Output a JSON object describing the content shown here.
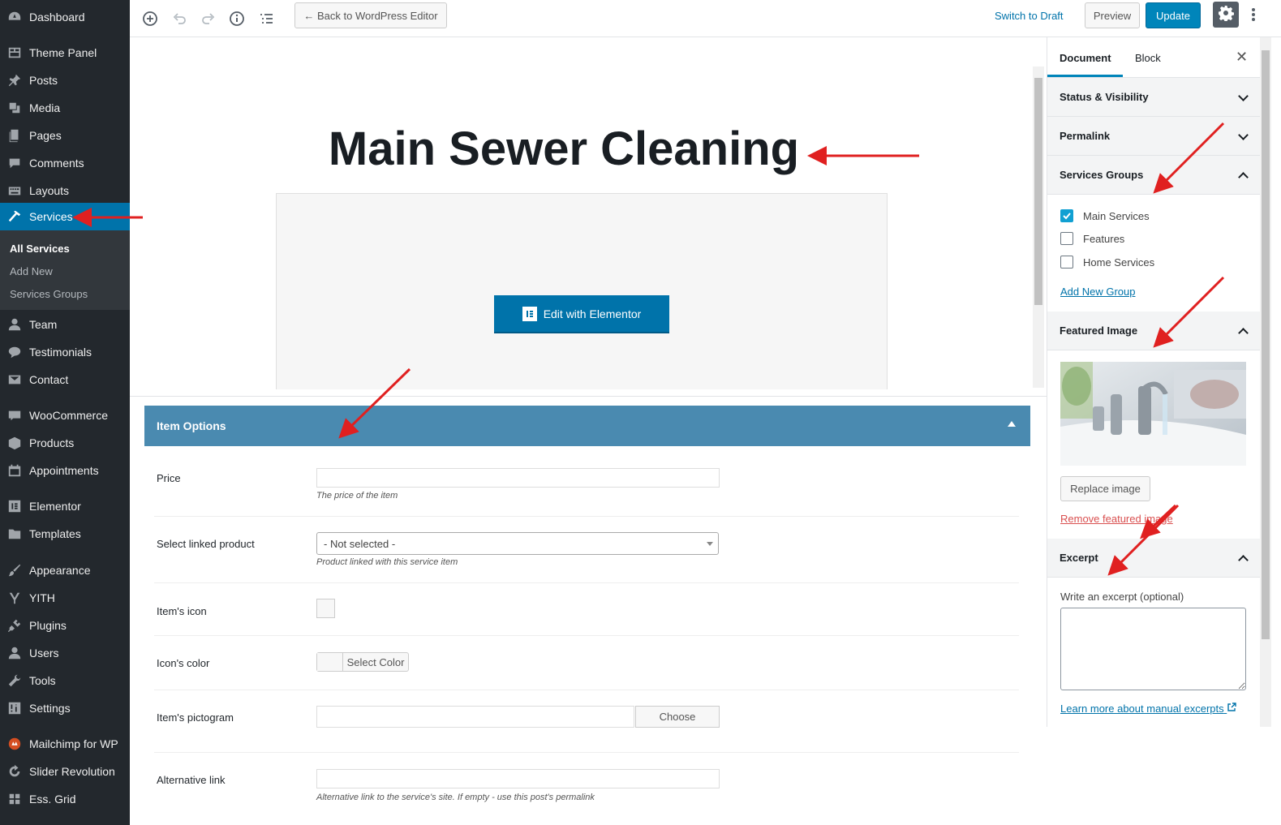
{
  "admin_menu": {
    "items": [
      {
        "label": "Dashboard",
        "icon": "dashboard-icon"
      },
      {
        "label": "Theme Panel",
        "icon": "theme-panel-icon"
      },
      {
        "label": "Posts",
        "icon": "pin-icon"
      },
      {
        "label": "Media",
        "icon": "media-icon"
      },
      {
        "label": "Pages",
        "icon": "pages-icon"
      },
      {
        "label": "Comments",
        "icon": "comments-icon"
      },
      {
        "label": "Layouts",
        "icon": "keyboard-icon"
      },
      {
        "label": "Services",
        "icon": "hammer-icon"
      },
      {
        "label": "Team",
        "icon": "person-icon"
      },
      {
        "label": "Testimonials",
        "icon": "chat-icon"
      },
      {
        "label": "Contact",
        "icon": "mail-icon"
      },
      {
        "label": "WooCommerce",
        "icon": "woo-icon"
      },
      {
        "label": "Products",
        "icon": "box-icon"
      },
      {
        "label": "Appointments",
        "icon": "calendar-icon"
      },
      {
        "label": "Elementor",
        "icon": "elementor-icon"
      },
      {
        "label": "Templates",
        "icon": "folder-icon"
      },
      {
        "label": "Appearance",
        "icon": "brush-icon"
      },
      {
        "label": "YITH",
        "icon": "yith-icon"
      },
      {
        "label": "Plugins",
        "icon": "plug-icon"
      },
      {
        "label": "Users",
        "icon": "user-icon"
      },
      {
        "label": "Tools",
        "icon": "wrench-icon"
      },
      {
        "label": "Settings",
        "icon": "sliders-icon"
      },
      {
        "label": "Mailchimp for WP",
        "icon": "mailchimp-icon"
      },
      {
        "label": "Slider Revolution",
        "icon": "refresh-icon"
      },
      {
        "label": "Ess. Grid",
        "icon": "grid-icon"
      }
    ],
    "submenu": [
      "All Services",
      "Add New",
      "Services Groups"
    ]
  },
  "toolbar": {
    "back_label": "← Back to WordPress Editor",
    "switch_draft": "Switch to Draft",
    "preview": "Preview",
    "update": "Update"
  },
  "editor": {
    "title": "Main Sewer Cleaning",
    "elementor_button": "Edit with Elementor"
  },
  "metabox": {
    "title": "Item Options",
    "price_label": "Price",
    "price_value": "",
    "price_desc": "The price of the item",
    "linked_label": "Select linked product",
    "linked_value": "- Not selected -",
    "linked_desc": "Product linked with this service item",
    "icon_label": "Item's icon",
    "color_label": "Icon's color",
    "color_button": "Select Color",
    "pictogram_label": "Item's pictogram",
    "choose_button": "Choose",
    "alt_label": "Alternative link",
    "alt_desc": "Alternative link to the service's site. If empty - use this post's permalink"
  },
  "sidebar": {
    "tabs": [
      "Document",
      "Block"
    ],
    "panels": {
      "status": "Status & Visibility",
      "permalink": "Permalink",
      "groups": "Services Groups",
      "featured": "Featured Image",
      "excerpt": "Excerpt"
    },
    "groups": [
      {
        "label": "Main Services",
        "checked": true
      },
      {
        "label": "Features",
        "checked": false
      },
      {
        "label": "Home Services",
        "checked": false
      }
    ],
    "add_group": "Add New Group",
    "replace_image": "Replace image",
    "remove_image": "Remove featured image",
    "excerpt_label": "Write an excerpt (optional)",
    "excerpt_value": "",
    "excerpt_link": "Learn more about manual excerpts"
  },
  "colors": {
    "admin_bg": "#23282d",
    "accent": "#0073aa",
    "metabox_head": "#4a8ab0",
    "annotation": "#e02020"
  }
}
